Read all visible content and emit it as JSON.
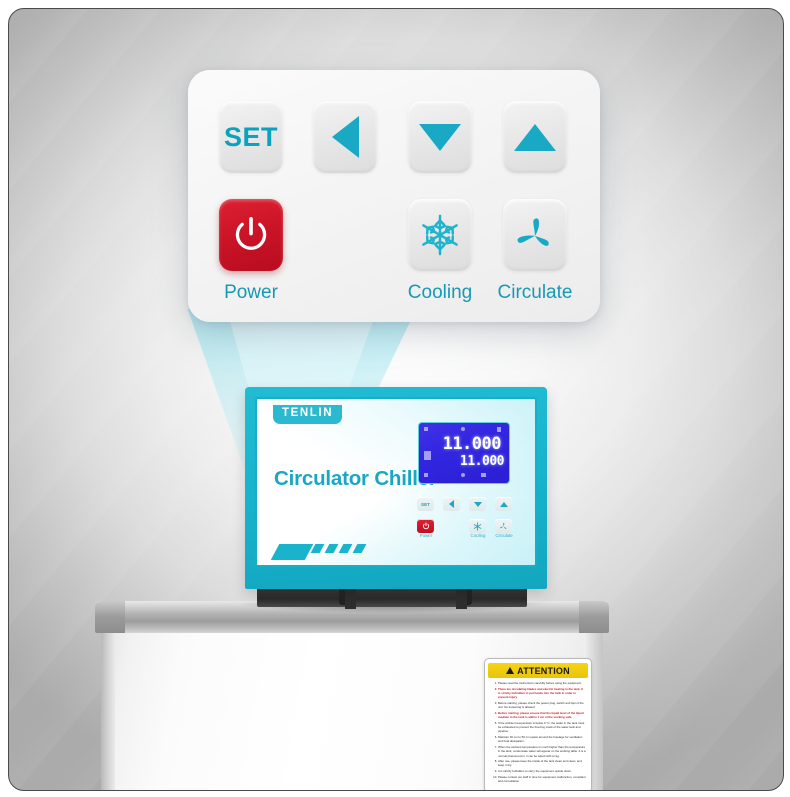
{
  "callout": {
    "keys_row1": [
      {
        "name": "set-button",
        "label": "SET",
        "icon": "text"
      },
      {
        "name": "left-button",
        "label": "",
        "icon": "triangle-left-icon"
      },
      {
        "name": "down-button",
        "label": "",
        "icon": "triangle-down-icon"
      },
      {
        "name": "up-button",
        "label": "",
        "icon": "triangle-up-icon"
      }
    ],
    "keys_row2": [
      {
        "name": "power-button",
        "label": "Power",
        "icon": "power-icon"
      },
      {
        "name": "cooling-button",
        "label": "Cooling",
        "icon": "snowflake-icon"
      },
      {
        "name": "circulate-button",
        "label": "Circulate",
        "icon": "fan-icon"
      }
    ],
    "set_label": "SET",
    "power_label": "Power",
    "cooling_label": "Cooling",
    "circulate_label": "Circulate"
  },
  "device": {
    "brand": "TENLIN",
    "product_name": "Circulator Chiller",
    "display": {
      "set_value": "11.000",
      "actual_value": "11.000"
    },
    "mini_keys": {
      "set": "SET",
      "power": "Power",
      "cooling": "Cooling",
      "circulate": "Circulate"
    }
  },
  "attention_label": {
    "title": "ATTENTION",
    "items": [
      {
        "text": "Please read the instructions carefully before using the equipment.",
        "warn": false
      },
      {
        "text": "There are circulating blades and electric heating in the tank. It is strictly forbidden to put hands into the tank in order to prevent injury.",
        "warn": true
      },
      {
        "text": "Before starting, please check the power plug, switch and lqui of the unit. No loosening is allowed.",
        "warn": false
      },
      {
        "text": "Before starting, please ensure that the liquid level of the liquid medium in the tank is within 1 cm of the working safe.",
        "warn": true
      },
      {
        "text": "If the ambient temperature is below 0 °C, the water in the tank must be exhausted to prevent the freezing crack of the water tank and pipeline.",
        "warn": false
      },
      {
        "text": "Maintain 30 cm to 50 cm space around the fuselage for ventilation and heat dissipation.",
        "warn": false
      },
      {
        "text": "When the ambient temperature is much higher than the temperature in the tank, condensate water will appear on the working table. It is a normal phenomenon, it can be wiped with a rag.",
        "warn": false
      },
      {
        "text": "After use, please keep the inside of the tank clean and clean, and keep it dry.",
        "warn": false
      },
      {
        "text": "It is strictly forbidden to carry the equipment upside down.",
        "warn": false
      },
      {
        "text": "Please contact our staff in time for equipment malfunction, complaint and consultation.",
        "warn": false
      }
    ]
  },
  "colors": {
    "teal": "#1aa9c4",
    "teal_dark": "#15b0c8",
    "red": "#c81225",
    "lcd_blue": "#3326e0",
    "yellow": "#f5d516"
  }
}
